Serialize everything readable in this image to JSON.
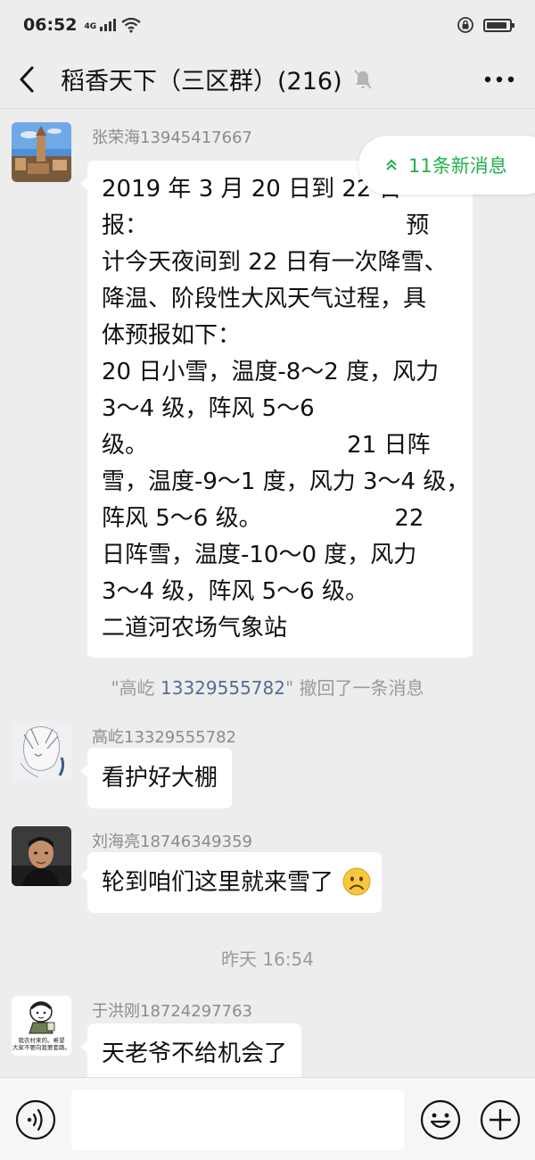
{
  "status": {
    "time": "06:52",
    "network": "4G"
  },
  "header": {
    "title": "稻香天下（三区群）(216)"
  },
  "new_messages_label": "11条新消息",
  "messages": [
    {
      "sender": "张荣海13945417667",
      "lines": [
        "2019 年 3 月 20 日到 22 日",
        "报：                                   预",
        "计今天夜间到 22 日有一次降雪、",
        "降温、阶段性大风天气过程，具",
        "体预报如下：",
        "20 日小雪，温度-8～2 度，风力",
        "3～4 级，阵风 5～6",
        "级。                           21 日阵",
        "雪，温度-9～1 度，风力 3～4 级，",
        "阵风 5～6 级。                  22",
        "日阵雪，温度-10～0 度，风力",
        "3～4 级，阵风 5～6 级。",
        "二道河农场气象站"
      ]
    },
    {
      "sender": "高屹13329555782",
      "lines": [
        "看护好大棚"
      ]
    },
    {
      "sender": "刘海亮18746349359",
      "lines": [
        "轮到咱们这里就来雪了"
      ]
    },
    {
      "sender": "于洪刚18724297763",
      "lines": [
        "天老爷不给机会了"
      ]
    }
  ],
  "recall_notice": {
    "prefix": "\"高屹 ",
    "name": "13329555782",
    "suffix": "\" 撤回了一条消息"
  },
  "timestamp": "昨天 16:54",
  "avatar4_caption": [
    "我农村来的。希望",
    "大家不要向我要套路。"
  ],
  "colors": {
    "accent_green": "#21b14c",
    "link_blue": "#576b95",
    "background": "#ededed"
  },
  "icons": [
    "back-arrow-icon",
    "mute-bell-icon",
    "more-icon",
    "voice-icon",
    "emoji-icon",
    "plus-icon",
    "sad-face-emoji",
    "double-chevron-up-icon"
  ]
}
